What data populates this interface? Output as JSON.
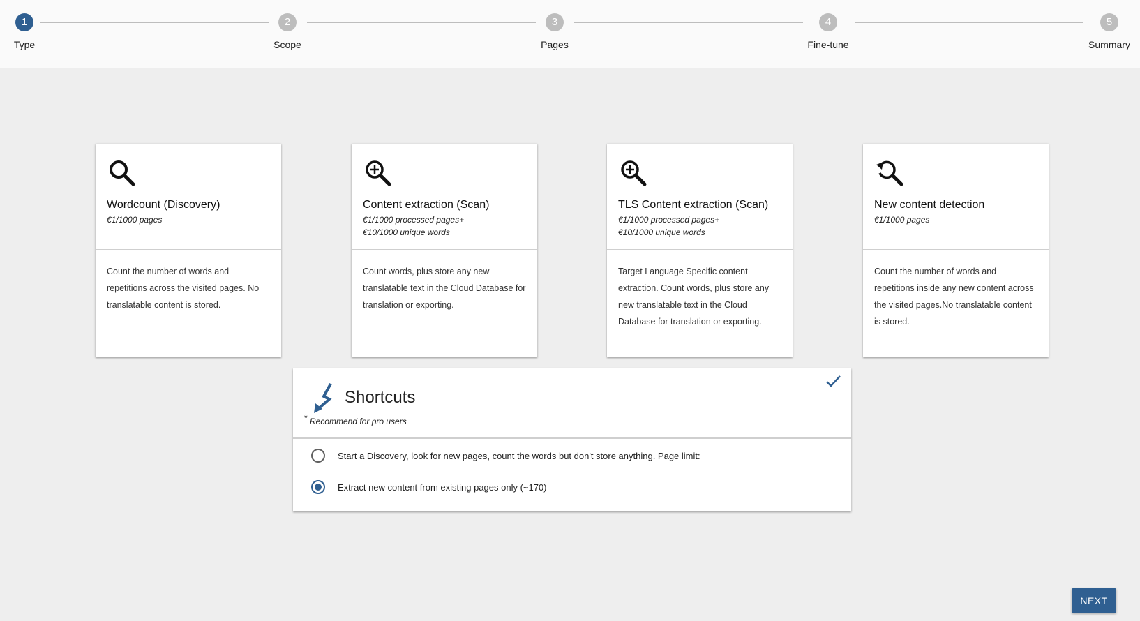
{
  "stepper": {
    "steps": [
      {
        "number": "1",
        "label": "Type",
        "active": true
      },
      {
        "number": "2",
        "label": "Scope",
        "active": false
      },
      {
        "number": "3",
        "label": "Pages",
        "active": false
      },
      {
        "number": "4",
        "label": "Fine-tune",
        "active": false
      },
      {
        "number": "5",
        "label": "Summary",
        "active": false
      }
    ]
  },
  "cards": [
    {
      "icon": "magnifier-icon",
      "title": "Wordcount (Discovery)",
      "price_lines": [
        "€1/1000 pages"
      ],
      "description": "Count the number of words and repetitions across the visited pages. No translatable content is stored."
    },
    {
      "icon": "zoom-in-icon",
      "title": "Content extraction (Scan)",
      "price_lines": [
        "€1/1000 processed pages+",
        "€10/1000 unique words"
      ],
      "description": "Count words, plus store any new translatable text in the Cloud Database for translation or exporting."
    },
    {
      "icon": "zoom-in-icon",
      "title": "TLS Content extraction (Scan)",
      "price_lines": [
        "€1/1000 processed pages+",
        "€10/1000 unique words"
      ],
      "description": "Target Language Specific content extraction. Count words, plus store any new translatable text in the Cloud Database for translation or exporting."
    },
    {
      "icon": "search-refresh-icon",
      "title": "New content detection",
      "price_lines": [
        "€1/1000 pages"
      ],
      "description": "Count the number of words and repetitions inside any new content across the visited pages.No translatable content is stored."
    }
  ],
  "shortcuts": {
    "icon": "lightning-icon",
    "title": "Shortcuts",
    "star": "*",
    "subtitle": "Recommend for pro users",
    "options": [
      {
        "label": "Start a Discovery, look for new pages, count the words but don't store anything. Page limit:",
        "checked": false
      },
      {
        "label": "Extract new content from existing pages only (~170)",
        "checked": true
      }
    ],
    "page_limit_value": ""
  },
  "footer": {
    "next_label": "NEXT"
  },
  "colors": {
    "accent": "#2f5f91",
    "inactive_step": "#bdbdbd",
    "background": "#eeeeee"
  }
}
